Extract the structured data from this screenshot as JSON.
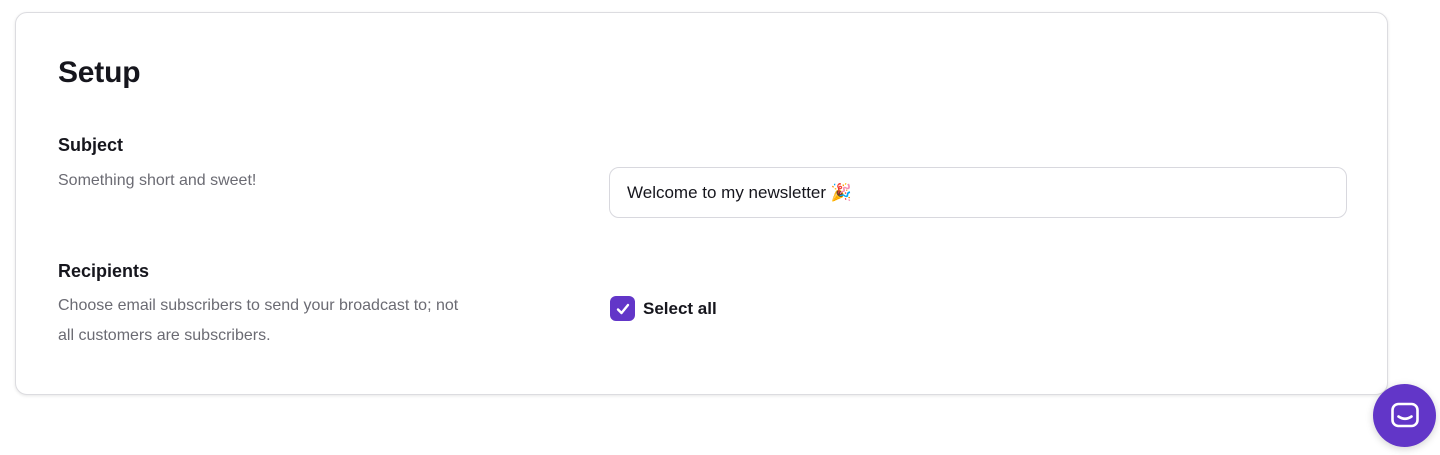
{
  "setup": {
    "title": "Setup",
    "subject": {
      "label": "Subject",
      "help": "Something short and sweet!",
      "value": "Welcome to my newsletter 🎉"
    },
    "recipients": {
      "label": "Recipients",
      "help": "Choose email subscribers to send your broadcast to; not all customers are subscribers.",
      "select_all_label": "Select all",
      "select_all_checked": true
    }
  },
  "chat_widget": {
    "icon": "chat-icon"
  },
  "colors": {
    "accent": "#6236c8",
    "text": "#16161d",
    "muted": "#6b6b73",
    "border": "#dcdce0"
  }
}
